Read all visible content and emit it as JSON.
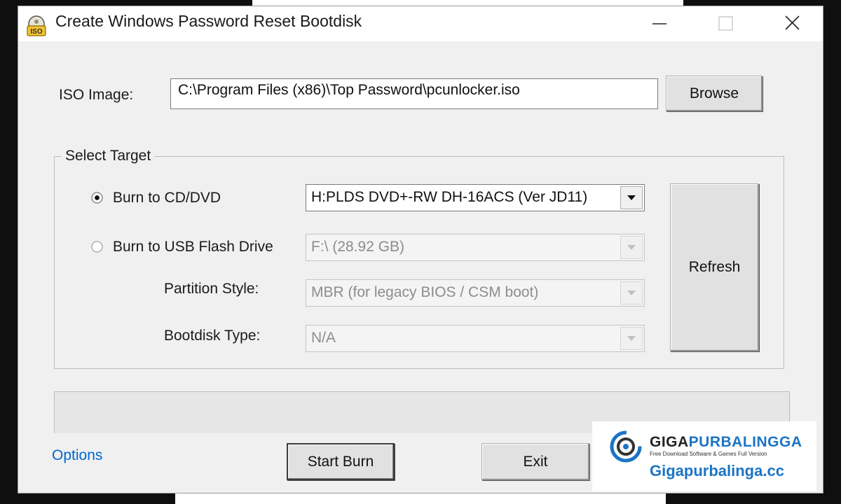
{
  "window": {
    "title": "Create Windows Password Reset Bootdisk",
    "icon_label": "ISO"
  },
  "iso": {
    "label": "ISO Image:",
    "path": "C:\\Program Files (x86)\\Top Password\\pcunlocker.iso",
    "browse_label": "Browse"
  },
  "target": {
    "group_title": "Select Target",
    "cd_option": {
      "label": "Burn to CD/DVD",
      "selected": true,
      "drive": "H:PLDS DVD+-RW DH-16ACS (Ver JD11)"
    },
    "usb_option": {
      "label": "Burn to USB Flash Drive",
      "selected": false,
      "drive": "F:\\ (28.92 GB)"
    },
    "partition": {
      "label": "Partition Style:",
      "value": "MBR (for legacy BIOS / CSM boot)"
    },
    "bootdisk": {
      "label": "Bootdisk Type:",
      "value": "N/A"
    },
    "refresh_label": "Refresh"
  },
  "footer": {
    "options_label": "Options",
    "start_label": "Start Burn",
    "exit_label": "Exit"
  },
  "watermark": {
    "brand_part1": "GIGA",
    "brand_part2": "PURBALINGGA",
    "tagline": "Free Download Software & Games Full Version",
    "url": "Gigapurbalinga.cc"
  },
  "colors": {
    "link": "#0066cc",
    "brand_blue": "#1b74c5"
  },
  "icons": [
    "app-iso-icon",
    "minimize-icon",
    "maximize-icon",
    "close-icon",
    "radio-selected-icon",
    "radio-unselected-icon",
    "dropdown-arrow-icon",
    "watermark-logo-icon"
  ]
}
